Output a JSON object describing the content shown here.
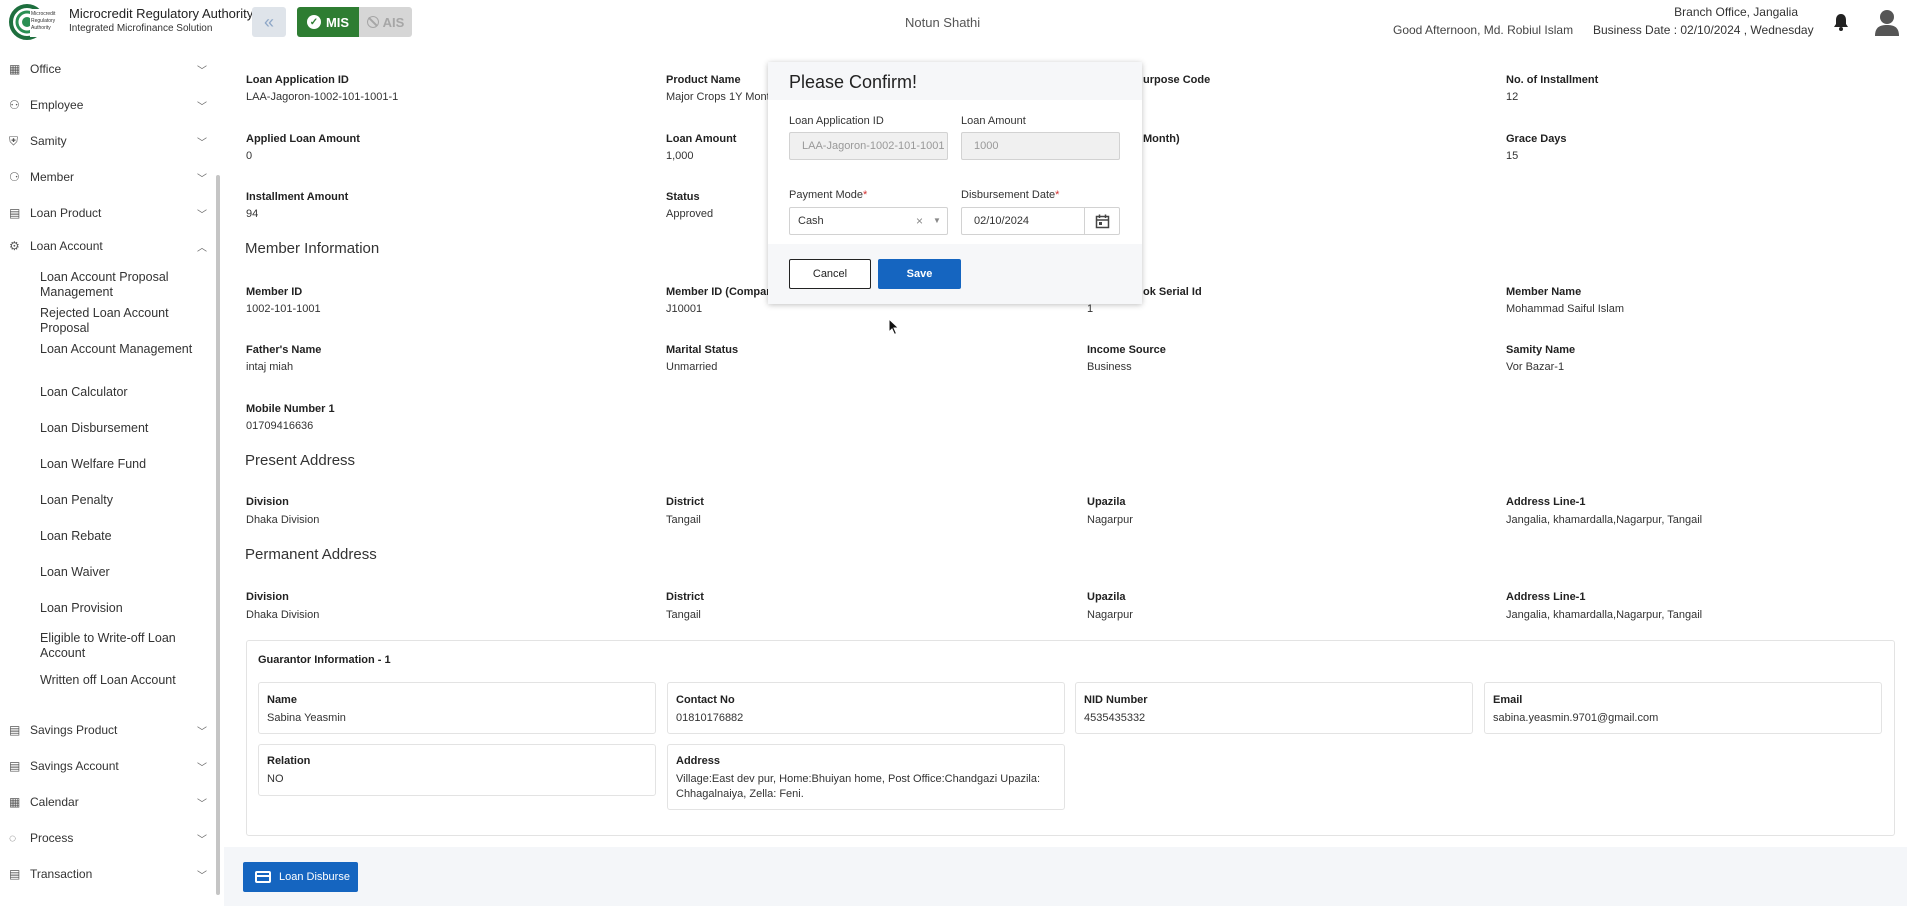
{
  "header": {
    "brand_title": "Microcredit Regulatory Authority",
    "brand_subtitle": "Integrated Microfinance Solution",
    "logo_text": "Microcredit Regulatory Authority",
    "mode_mis": "MIS",
    "mode_ais": "AIS",
    "app_name": "Notun Shathi",
    "branch": "Branch Office, Jangalia",
    "greeting": "Good Afternoon, Md. Robiul Islam",
    "business_date": "Business Date : 02/10/2024 , Wednesday"
  },
  "sidebar": {
    "items": [
      {
        "label": "Office",
        "icon": "office-icon"
      },
      {
        "label": "Employee",
        "icon": "employee-icon"
      },
      {
        "label": "Samity",
        "icon": "samity-icon"
      },
      {
        "label": "Member",
        "icon": "member-icon"
      },
      {
        "label": "Loan Product",
        "icon": "loan-product-icon"
      },
      {
        "label": "Loan Account",
        "icon": "loan-account-icon"
      },
      {
        "label": "Savings Product",
        "icon": "savings-product-icon"
      },
      {
        "label": "Savings Account",
        "icon": "savings-account-icon"
      },
      {
        "label": "Calendar",
        "icon": "calendar-icon"
      },
      {
        "label": "Process",
        "icon": "process-icon"
      },
      {
        "label": "Transaction",
        "icon": "transaction-icon"
      }
    ],
    "loan_account_sub": [
      "Loan Account Proposal Management",
      "Rejected Loan Account Proposal",
      "Loan Account Management",
      "Loan Calculator",
      "Loan Disbursement",
      "Loan Welfare Fund",
      "Loan Penalty",
      "Loan Rebate",
      "Loan Waiver",
      "Loan Provision",
      "Eligible to Write-off Loan Account",
      "Written off Loan Account"
    ]
  },
  "loan_info": {
    "application_id_label": "Loan Application ID",
    "application_id": "LAA-Jagoron-1002-101-1001-1",
    "product_name_label": "Product Name",
    "product_name": "Major Crops 1Y Month",
    "purpose_code_label": "urpose Code",
    "installments_label": "No. of Installment",
    "installments": "12",
    "applied_amount_label": "Applied Loan Amount",
    "applied_amount": "0",
    "loan_amount_label": "Loan Amount",
    "loan_amount": "1,000",
    "month_label": "Month)",
    "grace_days_label": "Grace Days",
    "grace_days": "15",
    "installment_amount_label": "Installment Amount",
    "installment_amount": "94",
    "status_label": "Status",
    "status": "Approved"
  },
  "member_info": {
    "title": "Member Information",
    "member_id_label": "Member ID",
    "member_id": "1002-101-1001",
    "member_id_company_label": "Member ID (Company",
    "member_id_company": "J10001",
    "passbook_label": "ok Serial Id",
    "passbook": "1",
    "member_name_label": "Member Name",
    "member_name": "Mohammad Saiful Islam",
    "father_label": "Father's Name",
    "father": "intaj miah",
    "marital_label": "Marital Status",
    "marital": "Unmarried",
    "income_label": "Income Source",
    "income": "Business",
    "samity_label": "Samity Name",
    "samity": "Vor Bazar-1",
    "mobile_label": "Mobile Number 1",
    "mobile": "01709416636"
  },
  "present_address": {
    "title": "Present Address",
    "division_label": "Division",
    "division": "Dhaka Division",
    "district_label": "District",
    "district": "Tangail",
    "upazila_label": "Upazila",
    "upazila": "Nagarpur",
    "address_label": "Address Line-1",
    "address": "Jangalia, khamardalla,Nagarpur, Tangail"
  },
  "permanent_address": {
    "title": "Permanent Address",
    "division_label": "Division",
    "division": "Dhaka Division",
    "district_label": "District",
    "district": "Tangail",
    "upazila_label": "Upazila",
    "upazila": "Nagarpur",
    "address_label": "Address Line-1",
    "address": "Jangalia, khamardalla,Nagarpur, Tangail"
  },
  "guarantor": {
    "title": "Guarantor Information - 1",
    "name_label": "Name",
    "name": "Sabina Yeasmin",
    "contact_label": "Contact No",
    "contact": "01810176882",
    "nid_label": "NID Number",
    "nid": "4535435332",
    "email_label": "Email",
    "email": "sabina.yeasmin.9701@gmail.com",
    "relation_label": "Relation",
    "relation": "NO",
    "address_label": "Address",
    "address_line1": "Village:East dev pur, Home:Bhuiyan home, Post Office:Chandgazi Upazila:",
    "address_line2": "Chhagalnaiya, Zella: Feni."
  },
  "actions": {
    "disburse_label": "Loan Disburse"
  },
  "dialog": {
    "title": "Please Confirm!",
    "app_id_label": "Loan Application ID",
    "app_id_value": "LAA-Jagoron-1002-101-1001",
    "loan_amount_label": "Loan Amount",
    "loan_amount_value": "1000",
    "payment_mode_label": "Payment Mode",
    "payment_mode_value": "Cash",
    "disbursement_date_label": "Disbursement Date",
    "disbursement_date_value": "02/10/2024",
    "required_mark": "*",
    "cancel_label": "Cancel",
    "save_label": "Save"
  },
  "colors": {
    "primary": "#1565c0",
    "mis_green": "#2e7d32"
  }
}
